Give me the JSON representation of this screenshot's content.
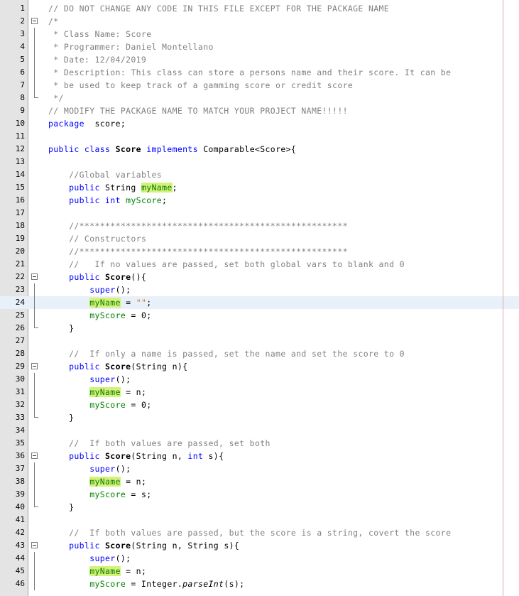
{
  "editor": {
    "fold_starts": [
      2,
      22,
      29,
      36,
      43
    ],
    "fold_ends": [
      8,
      26,
      33,
      40
    ],
    "fold_ranges": [
      [
        2,
        8
      ],
      [
        22,
        26
      ],
      [
        29,
        33
      ],
      [
        36,
        40
      ],
      [
        43,
        46
      ]
    ],
    "current_line": 24,
    "lines": [
      {
        "n": "1",
        "t": [
          [
            "cm",
            "// DO NOT CHANGE ANY CODE IN THIS FILE EXCEPT FOR THE PACKAGE NAME"
          ]
        ]
      },
      {
        "n": "2",
        "t": [
          [
            "cm",
            "/*"
          ]
        ]
      },
      {
        "n": "3",
        "t": [
          [
            "cm",
            " * Class Name: Score"
          ]
        ]
      },
      {
        "n": "4",
        "t": [
          [
            "cm",
            " * Programmer: Daniel Montellano"
          ]
        ]
      },
      {
        "n": "5",
        "t": [
          [
            "cm",
            " * Date: 12/04/2019"
          ]
        ]
      },
      {
        "n": "6",
        "t": [
          [
            "cm",
            " * Description: This class can store a persons name and their score. It can be"
          ]
        ]
      },
      {
        "n": "7",
        "t": [
          [
            "cm",
            " * be used to keep track of a gamming score or credit score"
          ]
        ]
      },
      {
        "n": "8",
        "t": [
          [
            "cm",
            " */"
          ]
        ]
      },
      {
        "n": "9",
        "t": [
          [
            "cm",
            "// MODIFY THE PACKAGE NAME TO MATCH YOUR PROJECT NAME!!!!!"
          ]
        ]
      },
      {
        "n": "10",
        "t": [
          [
            "kw",
            "package"
          ],
          [
            "",
            "  score;"
          ]
        ]
      },
      {
        "n": "11",
        "t": []
      },
      {
        "n": "12",
        "t": [
          [
            "kw",
            "public class "
          ],
          [
            "cls",
            "Score"
          ],
          [
            "kw",
            " implements "
          ],
          [
            "",
            "Comparable<Score>{"
          ]
        ]
      },
      {
        "n": "13",
        "t": []
      },
      {
        "n": "14",
        "t": [
          [
            "",
            "    "
          ],
          [
            "cm",
            "//Global variables"
          ]
        ]
      },
      {
        "n": "15",
        "t": [
          [
            "",
            "    "
          ],
          [
            "kw",
            "public"
          ],
          [
            "",
            " String "
          ],
          [
            "fld hl",
            "myName"
          ],
          [
            "",
            ";"
          ]
        ]
      },
      {
        "n": "16",
        "t": [
          [
            "",
            "    "
          ],
          [
            "kw",
            "public int "
          ],
          [
            "fld",
            "myScore"
          ],
          [
            "",
            ";"
          ]
        ]
      },
      {
        "n": "17",
        "t": []
      },
      {
        "n": "18",
        "t": [
          [
            "",
            "    "
          ],
          [
            "cm",
            "//****************************************************"
          ]
        ]
      },
      {
        "n": "19",
        "t": [
          [
            "",
            "    "
          ],
          [
            "cm",
            "// Constructors"
          ]
        ]
      },
      {
        "n": "20",
        "t": [
          [
            "",
            "    "
          ],
          [
            "cm",
            "//****************************************************"
          ]
        ]
      },
      {
        "n": "21",
        "t": [
          [
            "",
            "    "
          ],
          [
            "cm",
            "//   If no values are passed, set both global vars to blank and 0"
          ]
        ]
      },
      {
        "n": "22",
        "t": [
          [
            "",
            "    "
          ],
          [
            "kw",
            "public "
          ],
          [
            "cls",
            "Score"
          ],
          [
            "",
            "(){"
          ]
        ]
      },
      {
        "n": "23",
        "t": [
          [
            "",
            "        "
          ],
          [
            "kw",
            "super"
          ],
          [
            "",
            "();"
          ]
        ]
      },
      {
        "n": "24",
        "t": [
          [
            "",
            "        "
          ],
          [
            "fld hl",
            "myName"
          ],
          [
            "",
            " = "
          ],
          [
            "str",
            "\"\""
          ],
          [
            "",
            ";"
          ]
        ]
      },
      {
        "n": "25",
        "t": [
          [
            "",
            "        "
          ],
          [
            "fld",
            "myScore"
          ],
          [
            "",
            " = 0;"
          ]
        ]
      },
      {
        "n": "26",
        "t": [
          [
            "",
            "    }"
          ]
        ]
      },
      {
        "n": "27",
        "t": []
      },
      {
        "n": "28",
        "t": [
          [
            "",
            "    "
          ],
          [
            "cm",
            "//  If only a name is passed, set the name and set the score to 0"
          ]
        ]
      },
      {
        "n": "29",
        "t": [
          [
            "",
            "    "
          ],
          [
            "kw",
            "public "
          ],
          [
            "cls",
            "Score"
          ],
          [
            "",
            "(String n){"
          ]
        ]
      },
      {
        "n": "30",
        "t": [
          [
            "",
            "        "
          ],
          [
            "kw",
            "super"
          ],
          [
            "",
            "();"
          ]
        ]
      },
      {
        "n": "31",
        "t": [
          [
            "",
            "        "
          ],
          [
            "fld hl",
            "myName"
          ],
          [
            "",
            " = n;"
          ]
        ]
      },
      {
        "n": "32",
        "t": [
          [
            "",
            "        "
          ],
          [
            "fld",
            "myScore"
          ],
          [
            "",
            " = 0;"
          ]
        ]
      },
      {
        "n": "33",
        "t": [
          [
            "",
            "    }"
          ]
        ]
      },
      {
        "n": "34",
        "t": []
      },
      {
        "n": "35",
        "t": [
          [
            "",
            "    "
          ],
          [
            "cm",
            "//  If both values are passed, set both"
          ]
        ]
      },
      {
        "n": "36",
        "t": [
          [
            "",
            "    "
          ],
          [
            "kw",
            "public "
          ],
          [
            "cls",
            "Score"
          ],
          [
            "",
            "(String n, "
          ],
          [
            "kw",
            "int"
          ],
          [
            "",
            " s){"
          ]
        ]
      },
      {
        "n": "37",
        "t": [
          [
            "",
            "        "
          ],
          [
            "kw",
            "super"
          ],
          [
            "",
            "();"
          ]
        ]
      },
      {
        "n": "38",
        "t": [
          [
            "",
            "        "
          ],
          [
            "fld hl",
            "myName"
          ],
          [
            "",
            " = n;"
          ]
        ]
      },
      {
        "n": "39",
        "t": [
          [
            "",
            "        "
          ],
          [
            "fld",
            "myScore"
          ],
          [
            "",
            " = s;"
          ]
        ]
      },
      {
        "n": "40",
        "t": [
          [
            "",
            "    }"
          ]
        ]
      },
      {
        "n": "41",
        "t": []
      },
      {
        "n": "42",
        "t": [
          [
            "",
            "    "
          ],
          [
            "cm",
            "//  If both values are passed, but the score is a string, covert the score"
          ]
        ]
      },
      {
        "n": "43",
        "t": [
          [
            "",
            "    "
          ],
          [
            "kw",
            "public "
          ],
          [
            "cls",
            "Score"
          ],
          [
            "",
            "(String n, String s){"
          ]
        ]
      },
      {
        "n": "44",
        "t": [
          [
            "",
            "        "
          ],
          [
            "kw",
            "super"
          ],
          [
            "",
            "();"
          ]
        ]
      },
      {
        "n": "45",
        "t": [
          [
            "",
            "        "
          ],
          [
            "fld hl",
            "myName"
          ],
          [
            "",
            " = n;"
          ]
        ]
      },
      {
        "n": "46",
        "t": [
          [
            "",
            "        "
          ],
          [
            "fld",
            "myScore"
          ],
          [
            "",
            " = Integer."
          ],
          [
            "it",
            "parseInt"
          ],
          [
            "",
            "(s);"
          ]
        ]
      }
    ]
  },
  "colors": {
    "comment": "#808080",
    "keyword": "#0000ff",
    "field": "#008000",
    "highlight": "#d6f07a",
    "string": "#ce7b00",
    "gutter": "#e4e4e4",
    "current_line": "#e8f0fa",
    "right_margin": "#e8a0a0"
  }
}
